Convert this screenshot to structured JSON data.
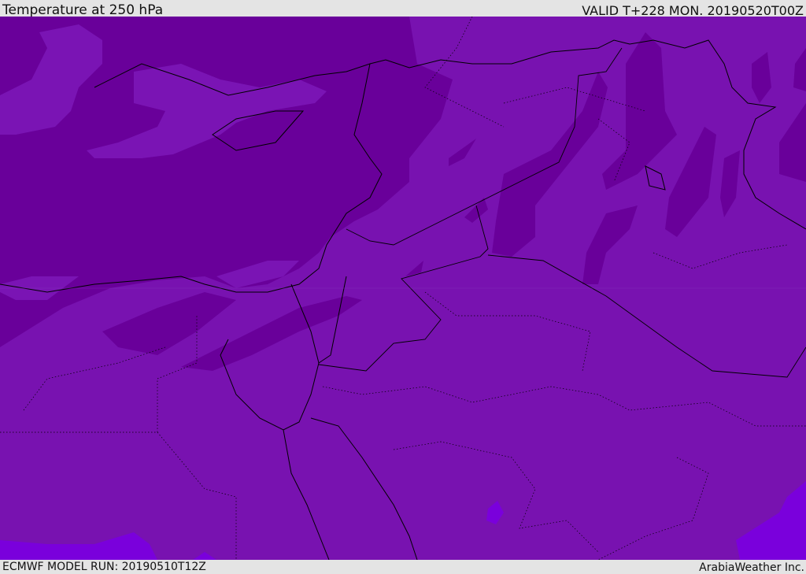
{
  "header": {
    "title": "Temperature at 250 hPa",
    "valid": "VALID T+228 MON. 20190520T00Z"
  },
  "footer": {
    "model_run": "ECMWF MODEL RUN: 20190510T12Z",
    "brand": "ArabiaWeather Inc."
  },
  "map": {
    "field": "temperature-250hPa",
    "colors": {
      "base": "#7812b0",
      "dark": "#69009a",
      "light": "#7c16b6",
      "warm": "#7a00dc",
      "lines": "#000000"
    }
  }
}
